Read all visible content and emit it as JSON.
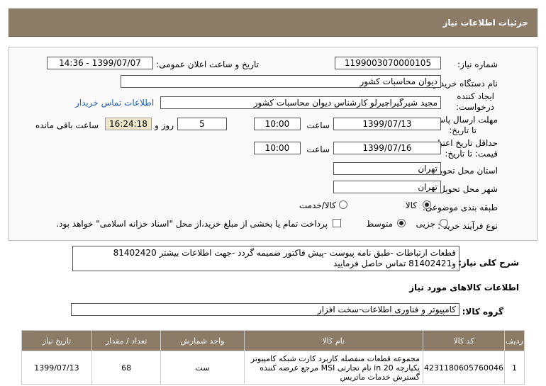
{
  "header": {
    "title": "جزئیات اطلاعات نیاز"
  },
  "form": {
    "need_number_label": "شماره نیاز:",
    "need_number": "1199003070000105",
    "announce_label": "تاریخ و ساعت اعلان عمومی:",
    "announce_value": "1399/07/07 - 14:36",
    "buyer_org_label": "نام دستگاه خریدار:",
    "buyer_org": "دیوان محاسبات کشور",
    "creator_label_1": "ایجاد کننده",
    "creator_label_2": "درخواست:",
    "creator": "مجید شیرگیراچیرلو کارشناس دیوان محاسبات کشور",
    "contact_link": "اطلاعات تماس خریدار",
    "deadline_label_1": "مهلت ارسال پاسخ:",
    "deadline_label_2": "تا تاریخ:",
    "deadline_date": "1399/07/13",
    "time_label": "ساعت",
    "deadline_time": "10:00",
    "days_value": "5",
    "days_label": "روز و",
    "remaining_time": "16:24:18",
    "remaining_label": "ساعت باقی مانده",
    "validity_label_1": "حداقل تاریخ اعتبار",
    "validity_label_2": "قیمت: تا تاریخ:",
    "validity_date": "1399/07/16",
    "validity_time": "10:00",
    "province_label": "استان محل تحویل:",
    "province": "تهران",
    "city_label": "شهر محل تحویل:",
    "city": "تهران",
    "category_label": "طبقه بندی موضوعی:",
    "category_options": [
      "کالا",
      "کالا/خدمت"
    ],
    "purchase_type_label": "نوع فرآیند خرید :",
    "purchase_options": [
      "جزیی",
      "متوسط"
    ],
    "payment_note": "پرداخت تمام یا بخشی از مبلغ خرید،از محل \"اسناد خزانه اسلامی\" خواهد بود."
  },
  "description": {
    "label": "شرح کلی نیاز:",
    "text": "قطعات ارتباطات -طبق نامه پیوست -پیش فاکتور ضمیمه گردد -جهت اطلاعات بیشتر 81402420 و81402421 تماس حاصل فرمایید"
  },
  "goods": {
    "section_title": "اطلاعات کالاهای مورد نیاز",
    "group_label": "گروه کالا:",
    "group_value": "کامپیوتر و فناوری اطلاعات-سخت افزار",
    "columns": [
      "ردیف",
      "کد کالا",
      "نام کالا",
      "واحد شمارش",
      "تعداد / مقدار",
      "تاریخ نیاز"
    ],
    "rows": [
      {
        "row": "1",
        "code": "4231180605760046",
        "name": "مجموعه قطعات منفصله کاربرد کارت شبکه کامپیوتر یکپارچه 20 in نام تجارتی MSI مرجع عرضه کننده گسترش خدمات ماتریس",
        "unit": "ست",
        "qty": "68",
        "date": "1399/07/13"
      }
    ]
  }
}
